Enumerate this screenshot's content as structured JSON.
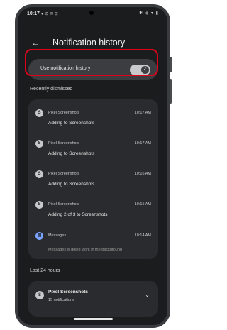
{
  "status_bar": {
    "time": "10:17",
    "left_icons": "● ⊙ ✉ ⊡",
    "right_icons": "✱ ◈ ▾ ▮"
  },
  "header": {
    "title": "Notification history",
    "back_icon": "arrow-left-icon"
  },
  "toggle": {
    "label": "Use notification history",
    "state": "on",
    "check": "✓",
    "highlight_color": "#e1001b"
  },
  "recently_dismissed": {
    "heading": "Recently dismissed",
    "items": [
      {
        "app": "Pixel Screenshots",
        "time": "10:17 AM",
        "message": "Adding to Screenshots",
        "icon": "S"
      },
      {
        "app": "Pixel Screenshots",
        "time": "10:17 AM",
        "message": "Adding to Screenshots",
        "icon": "S"
      },
      {
        "app": "Pixel Screenshots",
        "time": "10:16 AM",
        "message": "Adding to Screenshots",
        "icon": "S"
      },
      {
        "app": "Pixel Screenshots",
        "time": "10:15 AM",
        "message": "Adding 2 of 3 to Screenshots",
        "icon": "S"
      },
      {
        "app": "Messages",
        "time": "10:14 AM",
        "message": "Messages is doing work in the background",
        "icon": "▤"
      }
    ]
  },
  "last_24_hours": {
    "heading": "Last 24 hours",
    "app": "Pixel Screenshots",
    "count": "15 notifications",
    "icon": "S",
    "chevron": "⌄"
  }
}
